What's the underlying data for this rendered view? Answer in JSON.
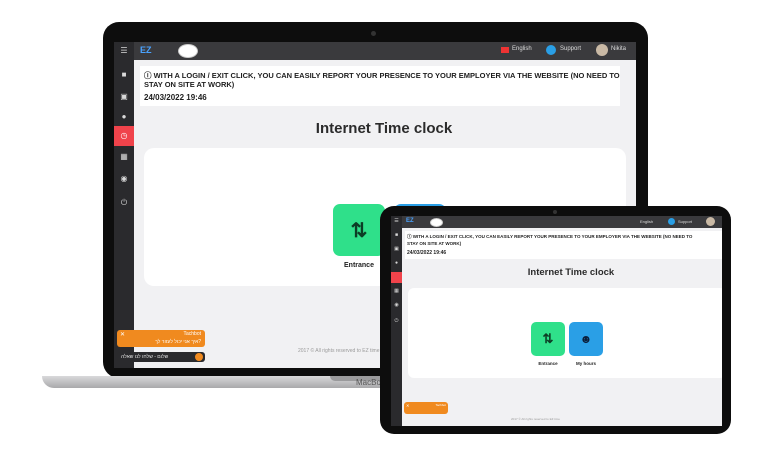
{
  "app": {
    "logo_text": "EZ",
    "language_label": "English",
    "support_label": "Support",
    "user_label": "Nikita"
  },
  "notice": {
    "line1": "WITH A LOGIN / EXIT CLICK, YOU CAN EASILY REPORT YOUR PRESENCE TO YOUR EMPLOYER VIA THE WEBSITE (NO NEED TO",
    "line2": "STAY ON SITE AT WORK)",
    "datetime": "24/03/2022 19:46"
  },
  "page": {
    "title": "Internet Time clock"
  },
  "actions": {
    "entrance_label": "Entrance",
    "my_hours_label": "My hours"
  },
  "toast": {
    "title": "Tachbot",
    "body": "איך אני יכול לעזור לך?"
  },
  "chat": {
    "text": "שלום - שלחו לנו שאלה"
  },
  "footer": {
    "text": "2017 © All rights reserved to EZ time"
  },
  "laptop": {
    "brand": "MacBook"
  },
  "colors": {
    "sidebar": "#2a2a2d",
    "topbar": "#3a3a3d",
    "active_item": "#f0434b",
    "entrance_tile": "#2fe08a",
    "hours_tile": "#2a9fe6",
    "toast": "#f08a1f"
  },
  "icons": {
    "menu": "hamburger-icon",
    "entrance": "arrows-up-down-icon",
    "my_hours": "person-clock-icon",
    "info": "info-circle-icon"
  }
}
